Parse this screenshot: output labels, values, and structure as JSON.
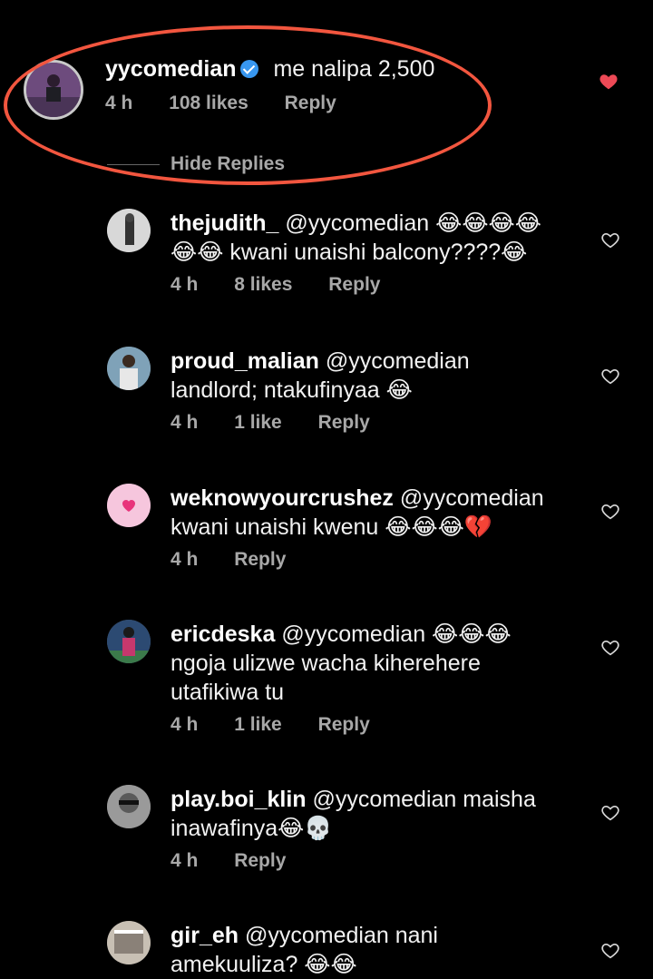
{
  "main_comment": {
    "username": "yycomedian",
    "text": "me nalipa 2,500",
    "time": "4 h",
    "likes": "108 likes",
    "reply": "Reply",
    "liked": true,
    "like_color": "#ed4956"
  },
  "hide_replies": "Hide Replies",
  "highlight_color": "#f2563f",
  "replies": [
    {
      "username": "thejudith_",
      "line1": "@yycomedian 😂😂😂😂",
      "line2": "😂😂 kwani unaishi balcony????😂",
      "time": "4 h",
      "likes": "8 likes",
      "reply": "Reply"
    },
    {
      "username": "proud_malian",
      "line1": "@yycomedian",
      "line2": "landlord; ntakufinyaa 😂",
      "time": "4 h",
      "likes": "1 like",
      "reply": "Reply"
    },
    {
      "username": "weknowyourcrushez",
      "line1": "@yycomedian",
      "line2": "kwani unaishi kwenu 😂😂😂💔",
      "time": "4 h",
      "reply": "Reply"
    },
    {
      "username": "ericdeska",
      "line1": "@yycomedian 😂😂😂",
      "line2": "ngoja ulizwe wacha kiherehere",
      "line3": "utafikiwa tu",
      "time": "4 h",
      "likes": "1 like",
      "reply": "Reply"
    },
    {
      "username": "play.boi_klin",
      "line1": "@yycomedian maisha",
      "line2": "inawafinya😂💀",
      "time": "4 h",
      "reply": "Reply"
    },
    {
      "username": "gir_eh",
      "line1": "@yycomedian nani",
      "line2": "amekuuliza? 😂😂"
    }
  ]
}
